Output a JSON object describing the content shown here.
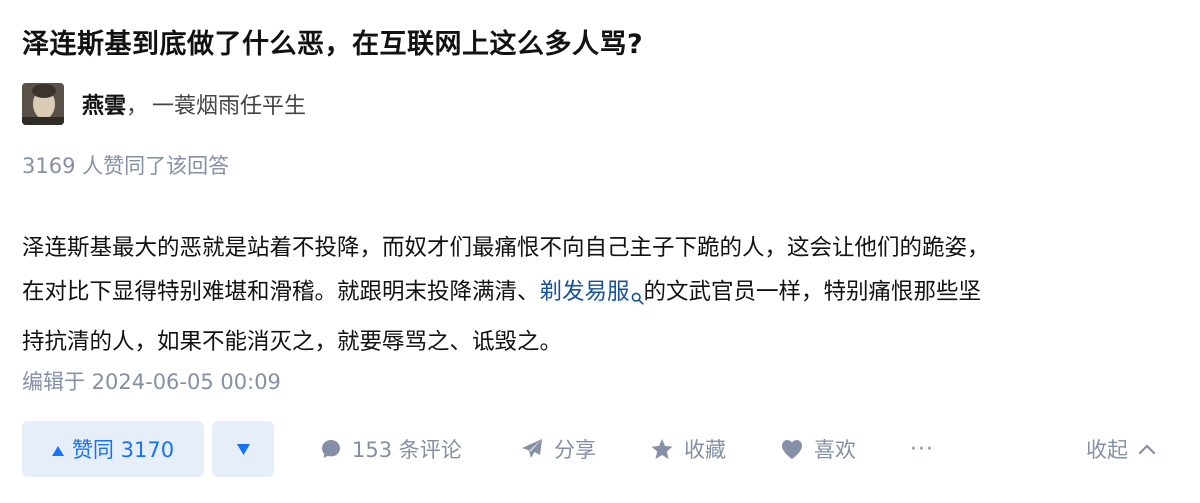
{
  "question": {
    "title": "泽连斯基到底做了什么恶，在互联网上这么多人骂?"
  },
  "author": {
    "name": "燕雲",
    "separator": "，",
    "headline": "一蓑烟雨任平生"
  },
  "vote_summary": "3169 人赞同了该回答",
  "answer": {
    "line1": "泽连斯基最大的恶就是站着不投降，而奴才们最痛恨不向自己主子下跪的人，这会让他们的跪姿，",
    "line2_before": "在对比下显得特别难堪和滑稽。就跟明末投降满清、",
    "line2_link": "剃发易服",
    "line2_after": "的文武官员一样，特别痛恨那些坚",
    "line3": "持抗清的人，如果不能消灭之，就要辱骂之、诋毁之。"
  },
  "edit_time": "编辑于 2024-06-05 00:09",
  "actions": {
    "upvote_label": "赞同 3170",
    "comment_label": "153 条评论",
    "share_label": "分享",
    "favorite_label": "收藏",
    "like_label": "喜欢",
    "more_label": "···",
    "collapse_label": "收起"
  },
  "icons": {
    "upvote": "triangle-up-icon",
    "downvote": "triangle-down-icon",
    "comment": "comment-bubble-icon",
    "share": "paper-plane-icon",
    "favorite": "star-icon",
    "like": "heart-icon",
    "collapse": "chevron-up-icon",
    "link_search": "search-icon"
  },
  "colors": {
    "accent": "#1772f6",
    "accent_bg": "#e6eefa",
    "muted": "#8590a6",
    "link": "#175199"
  }
}
